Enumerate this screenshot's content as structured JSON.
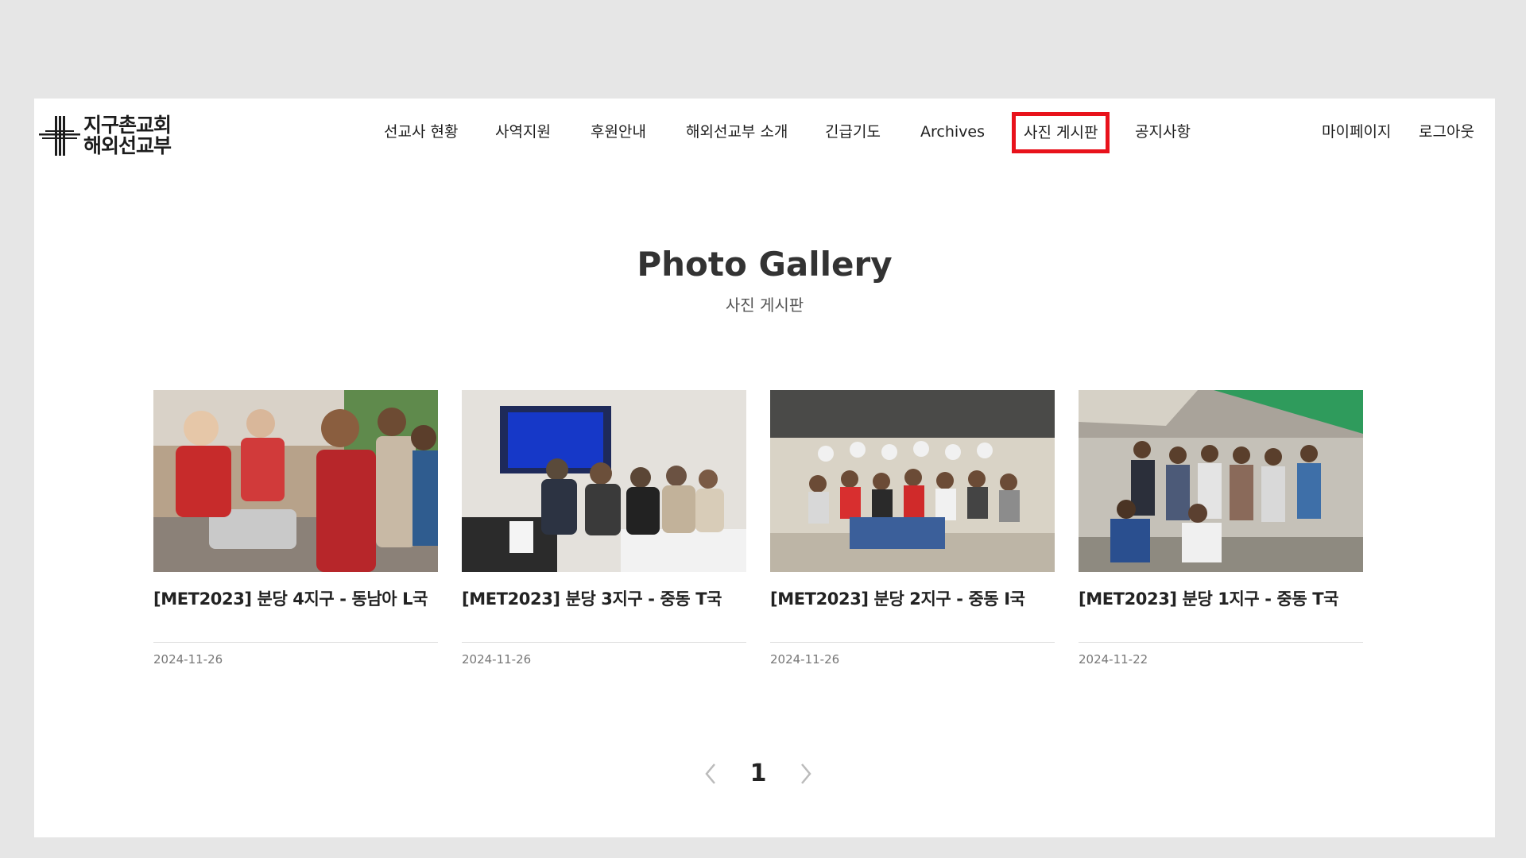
{
  "header": {
    "logo": {
      "line1": "지구촌교회",
      "line2": "해외선교부"
    },
    "nav": [
      {
        "label": "선교사 현황"
      },
      {
        "label": "사역지원"
      },
      {
        "label": "후원안내"
      },
      {
        "label": "해외선교부 소개"
      },
      {
        "label": "긴급기도"
      },
      {
        "label": "Archives"
      },
      {
        "label": "사진 게시판",
        "active": true
      },
      {
        "label": "공지사항"
      }
    ],
    "user": {
      "mypage": "마이페이지",
      "logout": "로그아웃"
    }
  },
  "page": {
    "title": "Photo Gallery",
    "subtitle": "사진 게시판"
  },
  "gallery": [
    {
      "title": "[MET2023] 분당 4지구 - 동남아 L국",
      "date": "2024-11-26"
    },
    {
      "title": "[MET2023] 분당 3지구 - 중동 T국",
      "date": "2024-11-26"
    },
    {
      "title": "[MET2023] 분당 2지구 - 중동 I국",
      "date": "2024-11-26"
    },
    {
      "title": "[MET2023] 분당 1지구 - 중동 T국",
      "date": "2024-11-22"
    }
  ],
  "pagination": {
    "prev_icon": "chevron-left-icon",
    "current": "1",
    "next_icon": "chevron-right-icon"
  },
  "colors": {
    "active_border": "#e8121b",
    "background": "#e6e6e6",
    "panel": "#ffffff"
  }
}
